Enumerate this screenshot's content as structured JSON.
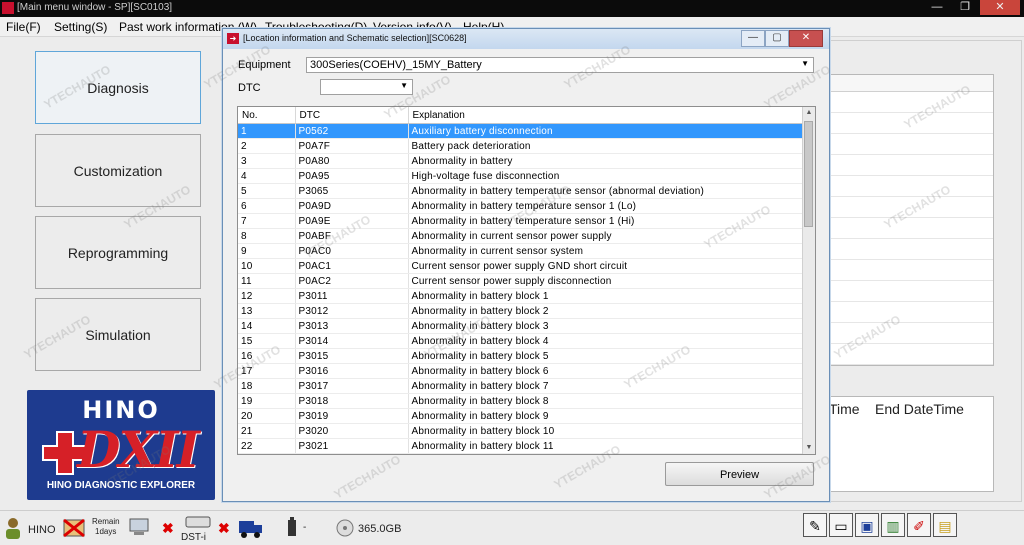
{
  "main_window": {
    "title": "[Main menu window - SP][SC0103]",
    "controls": {
      "minimize": "—",
      "maximize": "❐",
      "close": "✕"
    }
  },
  "menu": {
    "file": "File(F)",
    "setting": "Setting(S)",
    "past_work": "Past work information (W)",
    "troubleshooting": "Troubleshooting(D)",
    "version": "Version info(V)",
    "help": "Help(H)"
  },
  "nav": {
    "diagnosis": "Diagnosis",
    "customization": "Customization",
    "reprogramming": "Reprogramming",
    "simulation": "Simulation"
  },
  "logo": {
    "brand": "HINO",
    "product": "DXII",
    "tagline": "HINO DIAGNOSTIC EXPLORER",
    "colors": {
      "background": "#1e3b8f",
      "accent": "#d62027"
    }
  },
  "right_panel": {
    "col_time": "Time",
    "col_end": "End DateTime"
  },
  "dialog": {
    "title": "[Location information and Schematic selection][SC0628]",
    "controls": {
      "minimize": "—",
      "maximize": "▢",
      "close": "✕"
    },
    "equipment_label": "Equipment",
    "equipment_value": "300Series(COEHV)_15MY_Battery",
    "dtc_label": "DTC",
    "dtc_value": "",
    "columns": {
      "no": "No.",
      "dtc": "DTC",
      "explanation": "Explanation"
    },
    "selected_index": 0,
    "rows": [
      {
        "no": "1",
        "dtc": "P0562",
        "explanation": "Auxiliary battery disconnection"
      },
      {
        "no": "2",
        "dtc": "P0A7F",
        "explanation": "Battery pack deterioration"
      },
      {
        "no": "3",
        "dtc": "P0A80",
        "explanation": "Abnormality in battery"
      },
      {
        "no": "4",
        "dtc": "P0A95",
        "explanation": "High-voltage fuse disconnection"
      },
      {
        "no": "5",
        "dtc": "P3065",
        "explanation": "Abnormality in battery temperature sensor (abnormal deviation)"
      },
      {
        "no": "6",
        "dtc": "P0A9D",
        "explanation": "Abnormality in battery temperature sensor 1 (Lo)"
      },
      {
        "no": "7",
        "dtc": "P0A9E",
        "explanation": "Abnormality in battery temperature sensor 1 (Hi)"
      },
      {
        "no": "8",
        "dtc": "P0ABF",
        "explanation": "Abnormality in current sensor power supply"
      },
      {
        "no": "9",
        "dtc": "P0AC0",
        "explanation": "Abnormality in current sensor system"
      },
      {
        "no": "10",
        "dtc": "P0AC1",
        "explanation": "Current sensor power supply GND short circuit"
      },
      {
        "no": "11",
        "dtc": "P0AC2",
        "explanation": "Current sensor power supply disconnection"
      },
      {
        "no": "12",
        "dtc": "P3011",
        "explanation": "Abnormality in battery block 1"
      },
      {
        "no": "13",
        "dtc": "P3012",
        "explanation": "Abnormality in battery block 2"
      },
      {
        "no": "14",
        "dtc": "P3013",
        "explanation": "Abnormality in battery block 3"
      },
      {
        "no": "15",
        "dtc": "P3014",
        "explanation": "Abnormality in battery block 4"
      },
      {
        "no": "16",
        "dtc": "P3015",
        "explanation": "Abnormality in battery block 5"
      },
      {
        "no": "17",
        "dtc": "P3016",
        "explanation": "Abnormality in battery block 6"
      },
      {
        "no": "18",
        "dtc": "P3017",
        "explanation": "Abnormality in battery block 7"
      },
      {
        "no": "19",
        "dtc": "P3018",
        "explanation": "Abnormality in battery block 8"
      },
      {
        "no": "20",
        "dtc": "P3019",
        "explanation": "Abnormality in battery block 9"
      },
      {
        "no": "21",
        "dtc": "P3020",
        "explanation": "Abnormality in battery block 10"
      },
      {
        "no": "22",
        "dtc": "P3021",
        "explanation": "Abnormality in battery block 11"
      }
    ],
    "preview_button": "Preview"
  },
  "status_bar": {
    "user": "HINO",
    "remain_label": "Remain",
    "remain_days": "1days",
    "device": "DST-i",
    "battery": "-",
    "disk": "365.0GB"
  },
  "watermark": "YTECHAUTO",
  "toolbar_icons": [
    "pen-icon",
    "eraser-icon",
    "save-icon",
    "chart-icon",
    "edit-icon",
    "folder-icon"
  ]
}
